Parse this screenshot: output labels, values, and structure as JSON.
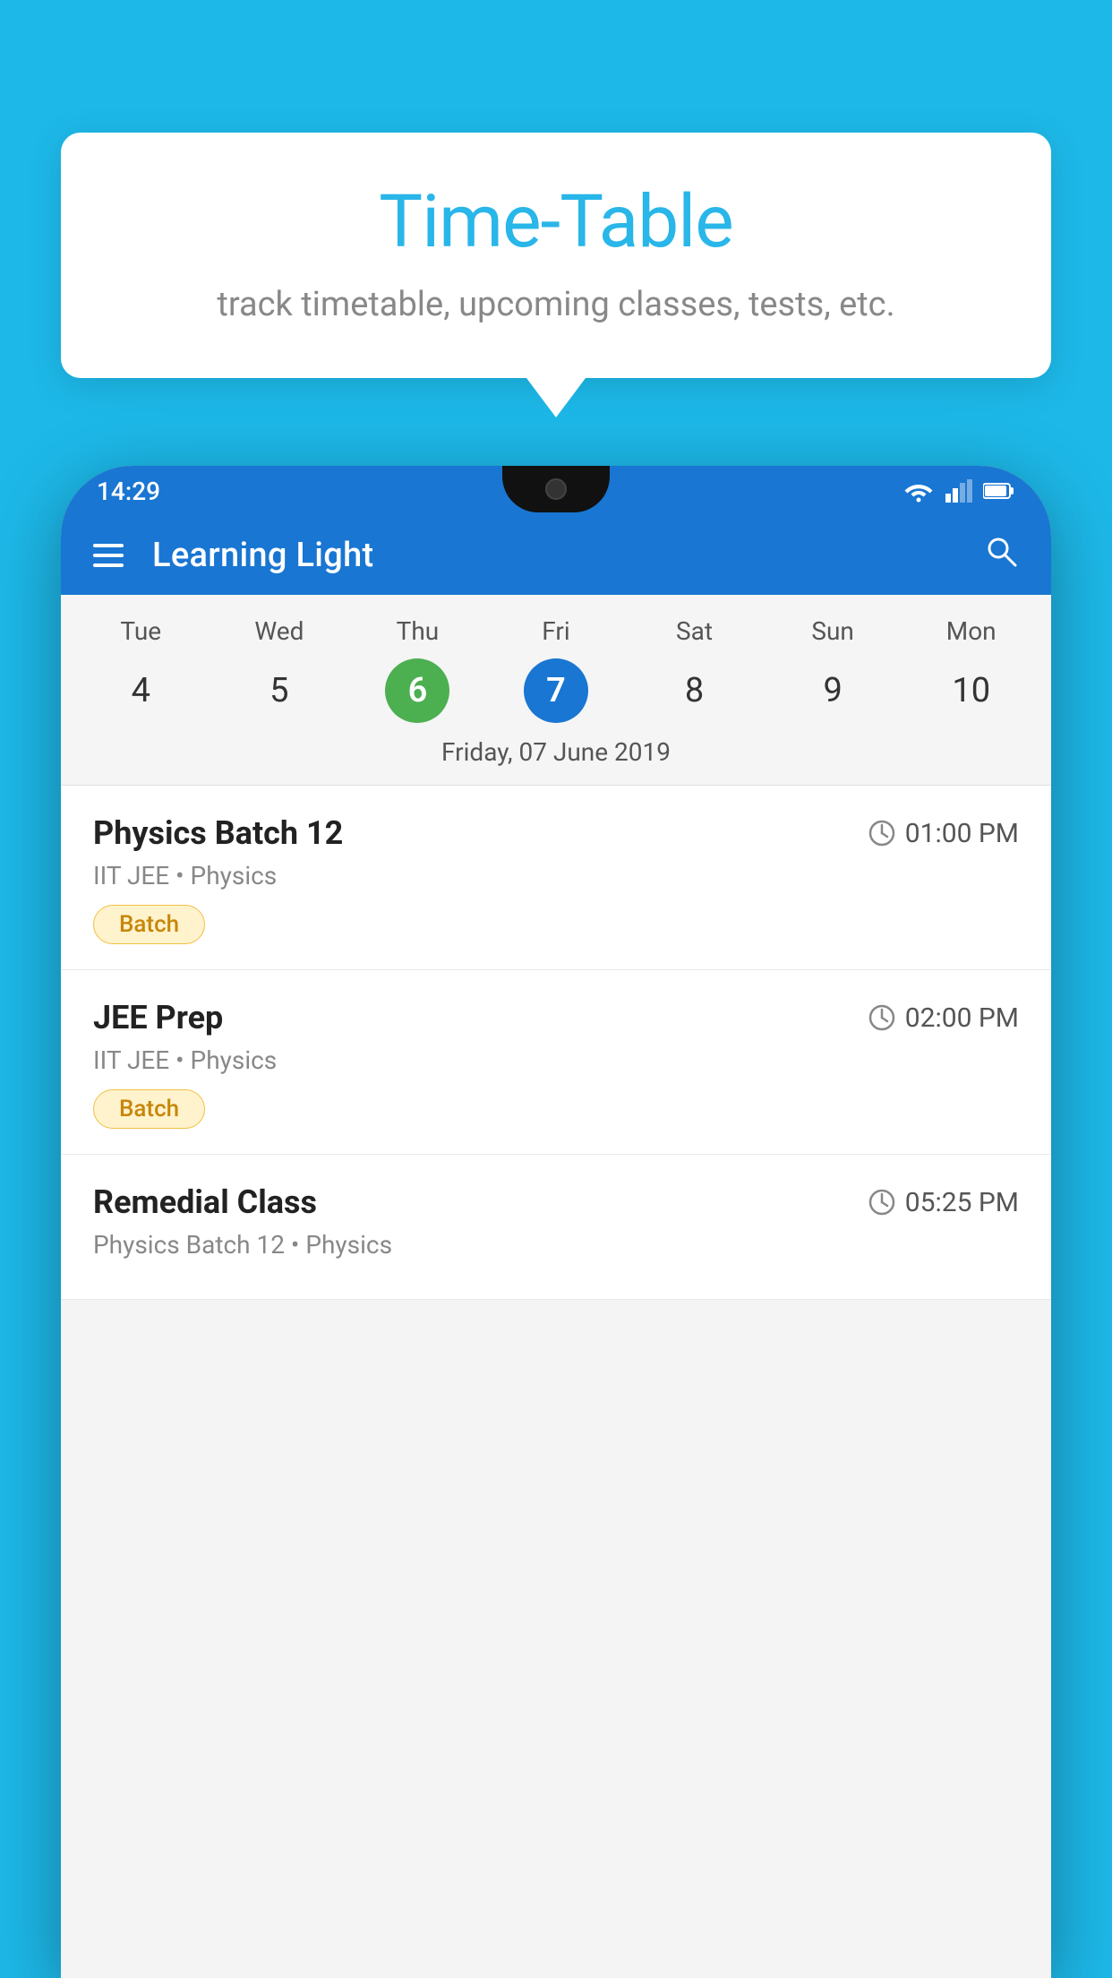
{
  "page": {
    "background_color": "#1DB8E8"
  },
  "tooltip": {
    "title": "Time-Table",
    "subtitle": "track timetable, upcoming classes, tests, etc."
  },
  "app": {
    "status_time": "14:29",
    "title": "Learning Light"
  },
  "calendar": {
    "selected_date_label": "Friday, 07 June 2019",
    "days": [
      {
        "name": "Tue",
        "number": "4",
        "state": "normal"
      },
      {
        "name": "Wed",
        "number": "5",
        "state": "normal"
      },
      {
        "name": "Thu",
        "number": "6",
        "state": "today"
      },
      {
        "name": "Fri",
        "number": "7",
        "state": "selected"
      },
      {
        "name": "Sat",
        "number": "8",
        "state": "normal"
      },
      {
        "name": "Sun",
        "number": "9",
        "state": "normal"
      },
      {
        "name": "Mon",
        "number": "10",
        "state": "normal"
      }
    ]
  },
  "schedule_items": [
    {
      "title": "Physics Batch 12",
      "time": "01:00 PM",
      "sub": "IIT JEE • Physics",
      "tag": "Batch"
    },
    {
      "title": "JEE Prep",
      "time": "02:00 PM",
      "sub": "IIT JEE • Physics",
      "tag": "Batch"
    },
    {
      "title": "Remedial Class",
      "time": "05:25 PM",
      "sub": "Physics Batch 12 • Physics",
      "tag": ""
    }
  ],
  "labels": {
    "hamburger": "☰",
    "search": "🔍",
    "clock": "🕐"
  }
}
